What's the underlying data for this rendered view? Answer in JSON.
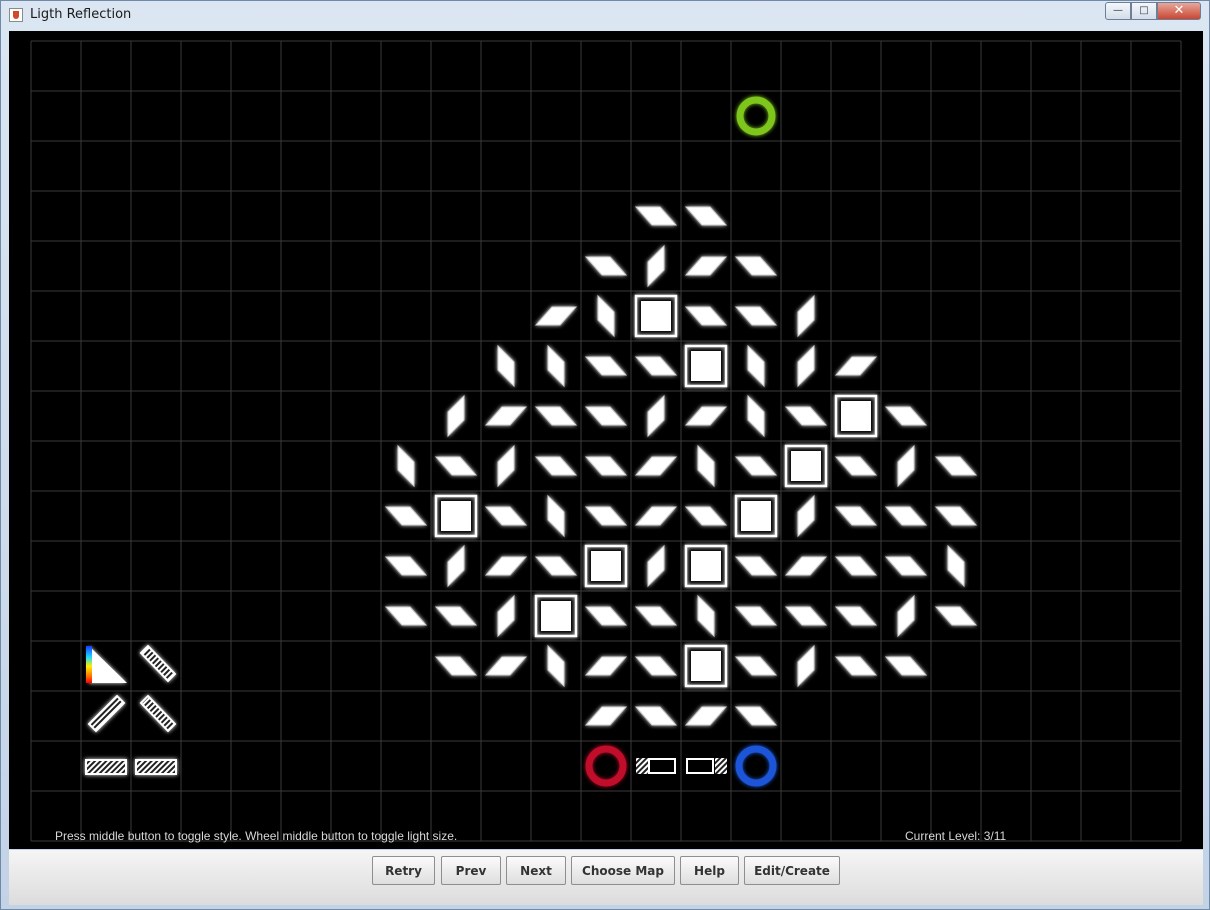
{
  "window": {
    "title": "Ligth Reflection"
  },
  "status": {
    "hint": "Press middle button to toggle style. Wheel middle button to toggle light size.",
    "level": "Current Level: 3/11"
  },
  "buttons": {
    "retry": "Retry",
    "prev": "Prev",
    "next": "Next",
    "choose_map": "Choose Map",
    "help": "Help",
    "edit_create": "Edit/Create"
  },
  "icons": {
    "target": "green-ring-target-icon",
    "source_red": "red-ring-light-source-icon",
    "source_blue": "blue-ring-light-source-icon"
  },
  "colors": {
    "target": "#7ec61e",
    "source_red": "#c0112a",
    "source_blue": "#1e55d8",
    "grid": "#3a3a3a",
    "laser": "#ffffff"
  },
  "board": {
    "cols": 23,
    "rows": 16,
    "_legend": "m=mirror '\\', n=mirror '/', v=vertical '\\' mirror, w=vertical '/' mirror, b=block",
    "pieces": [
      {
        "c": 12,
        "r": 3,
        "t": "m"
      },
      {
        "c": 13,
        "r": 3,
        "t": "m"
      },
      {
        "c": 11,
        "r": 4,
        "t": "m"
      },
      {
        "c": 12,
        "r": 4,
        "t": "w"
      },
      {
        "c": 13,
        "r": 4,
        "t": "n"
      },
      {
        "c": 14,
        "r": 4,
        "t": "m"
      },
      {
        "c": 10,
        "r": 5,
        "t": "n"
      },
      {
        "c": 11,
        "r": 5,
        "t": "v"
      },
      {
        "c": 12,
        "r": 5,
        "t": "b"
      },
      {
        "c": 13,
        "r": 5,
        "t": "m"
      },
      {
        "c": 14,
        "r": 5,
        "t": "m"
      },
      {
        "c": 15,
        "r": 5,
        "t": "w"
      },
      {
        "c": 9,
        "r": 6,
        "t": "v"
      },
      {
        "c": 10,
        "r": 6,
        "t": "v"
      },
      {
        "c": 11,
        "r": 6,
        "t": "m"
      },
      {
        "c": 12,
        "r": 6,
        "t": "m"
      },
      {
        "c": 13,
        "r": 6,
        "t": "b"
      },
      {
        "c": 14,
        "r": 6,
        "t": "v"
      },
      {
        "c": 15,
        "r": 6,
        "t": "w"
      },
      {
        "c": 16,
        "r": 6,
        "t": "n"
      },
      {
        "c": 8,
        "r": 7,
        "t": "w"
      },
      {
        "c": 9,
        "r": 7,
        "t": "n"
      },
      {
        "c": 10,
        "r": 7,
        "t": "m"
      },
      {
        "c": 11,
        "r": 7,
        "t": "m"
      },
      {
        "c": 12,
        "r": 7,
        "t": "w"
      },
      {
        "c": 13,
        "r": 7,
        "t": "n"
      },
      {
        "c": 14,
        "r": 7,
        "t": "v"
      },
      {
        "c": 15,
        "r": 7,
        "t": "m"
      },
      {
        "c": 16,
        "r": 7,
        "t": "b"
      },
      {
        "c": 17,
        "r": 7,
        "t": "m"
      },
      {
        "c": 7,
        "r": 8,
        "t": "v"
      },
      {
        "c": 8,
        "r": 8,
        "t": "m"
      },
      {
        "c": 9,
        "r": 8,
        "t": "w"
      },
      {
        "c": 10,
        "r": 8,
        "t": "m"
      },
      {
        "c": 11,
        "r": 8,
        "t": "m"
      },
      {
        "c": 12,
        "r": 8,
        "t": "n"
      },
      {
        "c": 13,
        "r": 8,
        "t": "v"
      },
      {
        "c": 14,
        "r": 8,
        "t": "m"
      },
      {
        "c": 15,
        "r": 8,
        "t": "b"
      },
      {
        "c": 16,
        "r": 8,
        "t": "m"
      },
      {
        "c": 17,
        "r": 8,
        "t": "w"
      },
      {
        "c": 18,
        "r": 8,
        "t": "m"
      },
      {
        "c": 7,
        "r": 9,
        "t": "m"
      },
      {
        "c": 8,
        "r": 9,
        "t": "b"
      },
      {
        "c": 9,
        "r": 9,
        "t": "m"
      },
      {
        "c": 10,
        "r": 9,
        "t": "v"
      },
      {
        "c": 11,
        "r": 9,
        "t": "m"
      },
      {
        "c": 12,
        "r": 9,
        "t": "n"
      },
      {
        "c": 13,
        "r": 9,
        "t": "m"
      },
      {
        "c": 14,
        "r": 9,
        "t": "b"
      },
      {
        "c": 15,
        "r": 9,
        "t": "w"
      },
      {
        "c": 16,
        "r": 9,
        "t": "m"
      },
      {
        "c": 17,
        "r": 9,
        "t": "m"
      },
      {
        "c": 18,
        "r": 9,
        "t": "m"
      },
      {
        "c": 7,
        "r": 10,
        "t": "m"
      },
      {
        "c": 8,
        "r": 10,
        "t": "w"
      },
      {
        "c": 9,
        "r": 10,
        "t": "n"
      },
      {
        "c": 10,
        "r": 10,
        "t": "m"
      },
      {
        "c": 11,
        "r": 10,
        "t": "b"
      },
      {
        "c": 12,
        "r": 10,
        "t": "w"
      },
      {
        "c": 13,
        "r": 10,
        "t": "b"
      },
      {
        "c": 14,
        "r": 10,
        "t": "m"
      },
      {
        "c": 15,
        "r": 10,
        "t": "n"
      },
      {
        "c": 16,
        "r": 10,
        "t": "m"
      },
      {
        "c": 17,
        "r": 10,
        "t": "m"
      },
      {
        "c": 18,
        "r": 10,
        "t": "v"
      },
      {
        "c": 7,
        "r": 11,
        "t": "m"
      },
      {
        "c": 8,
        "r": 11,
        "t": "m"
      },
      {
        "c": 9,
        "r": 11,
        "t": "w"
      },
      {
        "c": 10,
        "r": 11,
        "t": "b"
      },
      {
        "c": 11,
        "r": 11,
        "t": "m"
      },
      {
        "c": 12,
        "r": 11,
        "t": "m"
      },
      {
        "c": 13,
        "r": 11,
        "t": "v"
      },
      {
        "c": 14,
        "r": 11,
        "t": "m"
      },
      {
        "c": 15,
        "r": 11,
        "t": "m"
      },
      {
        "c": 16,
        "r": 11,
        "t": "m"
      },
      {
        "c": 17,
        "r": 11,
        "t": "w"
      },
      {
        "c": 18,
        "r": 11,
        "t": "m"
      },
      {
        "c": 8,
        "r": 12,
        "t": "m"
      },
      {
        "c": 9,
        "r": 12,
        "t": "n"
      },
      {
        "c": 10,
        "r": 12,
        "t": "v"
      },
      {
        "c": 11,
        "r": 12,
        "t": "n"
      },
      {
        "c": 12,
        "r": 12,
        "t": "m"
      },
      {
        "c": 13,
        "r": 12,
        "t": "b"
      },
      {
        "c": 14,
        "r": 12,
        "t": "m"
      },
      {
        "c": 15,
        "r": 12,
        "t": "w"
      },
      {
        "c": 16,
        "r": 12,
        "t": "m"
      },
      {
        "c": 17,
        "r": 12,
        "t": "m"
      },
      {
        "c": 11,
        "r": 13,
        "t": "n"
      },
      {
        "c": 12,
        "r": 13,
        "t": "m"
      },
      {
        "c": 13,
        "r": 13,
        "t": "n"
      },
      {
        "c": 14,
        "r": 13,
        "t": "m"
      }
    ]
  }
}
